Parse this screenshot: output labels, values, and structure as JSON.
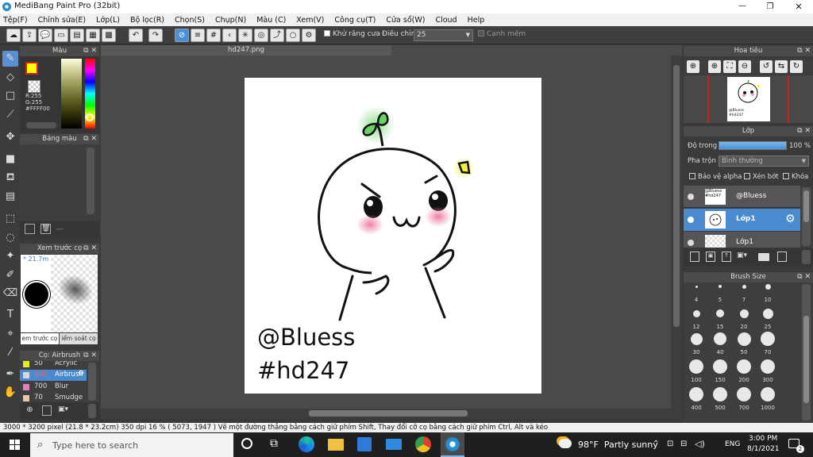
{
  "window": {
    "title": "MediBang Paint Pro (32bit)",
    "controls": [
      "—",
      "❐",
      "✕"
    ]
  },
  "menu": [
    "Tệp(F)",
    "Chỉnh sửa(E)",
    "Lớp(L)",
    "Bộ lọc(R)",
    "Chọn(S)",
    "Chụp(N)",
    "Màu (C)",
    "Xem(V)",
    "Công cụ(T)",
    "Cửa sổ(W)",
    "Cloud",
    "Help"
  ],
  "toolbar": {
    "antialias_label": "Khử răng cưa",
    "adjust_label": "Điều chỉnh",
    "adjust_value": "25",
    "edge_label": "Cạnh mềm"
  },
  "color_panel": {
    "title": "Màu",
    "r": "R:255",
    "g": "G:255",
    "hex": "#FFFF00"
  },
  "palette_panel": {
    "title": "Bảng màu",
    "dash": "---"
  },
  "preview_panel": {
    "title": "Xem trước cọ",
    "size": "* 21.7m",
    "tab1": "em trước cọ",
    "tab2": "iểm soát cọ"
  },
  "brush_panel": {
    "title": "Cọ: Airbrush",
    "items": [
      {
        "size": "50",
        "name": "Acrylic",
        "color": "#e8e820"
      },
      {
        "size": "300",
        "name": "Airbrush",
        "color": "#d8d8d8",
        "selected": true
      },
      {
        "size": "700",
        "name": "Blur",
        "color": "#e080c0"
      },
      {
        "size": "70",
        "name": "Smudge",
        "color": "#e8c8a0"
      }
    ]
  },
  "document": {
    "tab": "hd247.png",
    "text1": "@Bluess",
    "text2": "#hd247"
  },
  "navigator": {
    "title": "Hoa tiêu",
    "thumb_text": "@Bluess\n#hd247"
  },
  "layer_panel": {
    "title": "Lớp",
    "opacity_label": "Độ trong",
    "opacity_value": "100 %",
    "opacity_fraction": 1.0,
    "blend_label": "Pha trộn",
    "blend_value": "Bình thường",
    "protect_alpha": "Bảo vệ alpha",
    "clipping": "Xén bớt",
    "lock": "Khóa",
    "layers": [
      {
        "name": "@Bluess",
        "thumb": "@Bluess #hd247"
      },
      {
        "name": "Lớp1",
        "selected": true
      },
      {
        "name": "Lớp1"
      }
    ]
  },
  "brush_size_panel": {
    "title": "Brush Size",
    "sizes": [
      "4",
      "5",
      "7",
      "10",
      "12",
      "15",
      "20",
      "25",
      "30",
      "40",
      "50",
      "70",
      "100",
      "150",
      "200",
      "300",
      "400",
      "500",
      "700",
      "1000"
    ]
  },
  "status": "3000 * 3200 pixel  (21.8 * 23.2cm)  350 dpi  16 %  ( 5073, 1947 )  Vẽ một đường thẳng bằng cách giữ phím Shift, Thay đổi cỡ cọ bằng cách giữ phím Ctrl, Alt và kéo",
  "taskbar": {
    "search_placeholder": "Type here to search",
    "weather": "98°F  Partly sunny",
    "lang": "ENG",
    "time": "3:00 PM",
    "date": "8/1/2021",
    "notif": "2"
  }
}
